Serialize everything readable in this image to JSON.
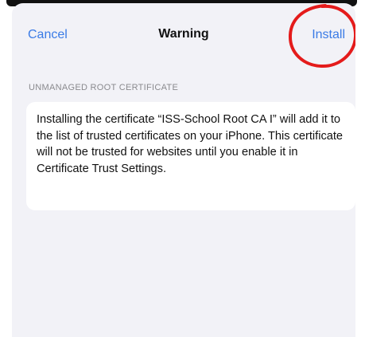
{
  "nav": {
    "cancel_label": "Cancel",
    "title": "Warning",
    "install_label": "Install"
  },
  "section": {
    "header": "UNMANAGED ROOT CERTIFICATE",
    "message": "Installing the certificate “ISS-School Root CA I” will add it to the list of trusted certificates on your iPhone. This certificate will not be trusted for websites until you enable it in Certificate Trust Settings."
  },
  "colors": {
    "accent": "#3a7be6",
    "background": "#f2f2f7",
    "card": "#ffffff",
    "annotation": "#e41b1b"
  }
}
